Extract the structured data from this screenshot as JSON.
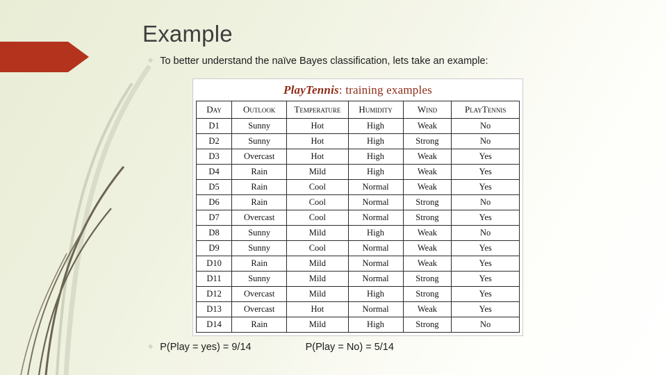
{
  "slide": {
    "title": "Example",
    "intro_bullet": "To better understand the naïve Bayes classification, lets take an example:",
    "bullet_glyph": "✧",
    "prob_yes": "P(Play = yes) = 9/14",
    "prob_no": "P(Play = No) = 5/14"
  },
  "table": {
    "caption_italic": "PlayTennis",
    "caption_rest": ": training examples",
    "headers": [
      "Day",
      "Outlook",
      "Temperature",
      "Humidity",
      "Wind",
      "PlayTennis"
    ],
    "rows": [
      {
        "cells": [
          "D1",
          "Sunny",
          "Hot",
          "High",
          "Weak",
          "No"
        ],
        "colors": [
          "dark",
          "dark",
          "dark",
          "dark",
          "dark",
          "dark"
        ]
      },
      {
        "cells": [
          "D2",
          "Sunny",
          "Hot",
          "High",
          "Strong",
          "No"
        ],
        "colors": [
          "dark",
          "dark",
          "dark",
          "dark",
          "dark",
          "dark"
        ]
      },
      {
        "cells": [
          "D3",
          "Overcast",
          "Hot",
          "High",
          "Weak",
          "Yes"
        ],
        "colors": [
          "dark",
          "red",
          "dark",
          "dark",
          "red",
          "red"
        ]
      },
      {
        "cells": [
          "D4",
          "Rain",
          "Mild",
          "High",
          "Weak",
          "Yes"
        ],
        "colors": [
          "dark",
          "red",
          "red",
          "dark",
          "red",
          "red"
        ]
      },
      {
        "cells": [
          "D5",
          "Rain",
          "Cool",
          "Normal",
          "Weak",
          "Yes"
        ],
        "colors": [
          "dark",
          "red",
          "red",
          "red",
          "red",
          "red"
        ]
      },
      {
        "cells": [
          "D6",
          "Rain",
          "Cool",
          "Normal",
          "Strong",
          "No"
        ],
        "colors": [
          "dark",
          "dark",
          "dark",
          "dark",
          "dark",
          "dark"
        ]
      },
      {
        "cells": [
          "D7",
          "Overcast",
          "Cool",
          "Normal",
          "Strong",
          "Yes"
        ],
        "colors": [
          "dark",
          "red",
          "red",
          "red",
          "red",
          "red"
        ]
      },
      {
        "cells": [
          "D8",
          "Sunny",
          "Mild",
          "High",
          "Weak",
          "No"
        ],
        "colors": [
          "dark",
          "dark",
          "dark",
          "dark",
          "dark",
          "dark"
        ]
      },
      {
        "cells": [
          "D9",
          "Sunny",
          "Cool",
          "Normal",
          "Weak",
          "Yes"
        ],
        "colors": [
          "dark",
          "red",
          "red",
          "red",
          "red",
          "red"
        ]
      },
      {
        "cells": [
          "D10",
          "Rain",
          "Mild",
          "Normal",
          "Weak",
          "Yes"
        ],
        "colors": [
          "dark",
          "red",
          "red",
          "red",
          "red",
          "red"
        ]
      },
      {
        "cells": [
          "D11",
          "Sunny",
          "Mild",
          "Normal",
          "Strong",
          "Yes"
        ],
        "colors": [
          "dark",
          "red",
          "red",
          "red",
          "red",
          "red"
        ]
      },
      {
        "cells": [
          "D12",
          "Overcast",
          "Mild",
          "High",
          "Strong",
          "Yes"
        ],
        "colors": [
          "dark",
          "red",
          "red",
          "dark",
          "red",
          "red"
        ]
      },
      {
        "cells": [
          "D13",
          "Overcast",
          "Hot",
          "Normal",
          "Weak",
          "Yes"
        ],
        "colors": [
          "dark",
          "red",
          "red",
          "red",
          "red",
          "red"
        ]
      },
      {
        "cells": [
          "D14",
          "Rain",
          "Mild",
          "High",
          "Strong",
          "No"
        ],
        "colors": [
          "dark",
          "dark",
          "dark",
          "dark",
          "dark",
          "dark"
        ]
      }
    ]
  }
}
